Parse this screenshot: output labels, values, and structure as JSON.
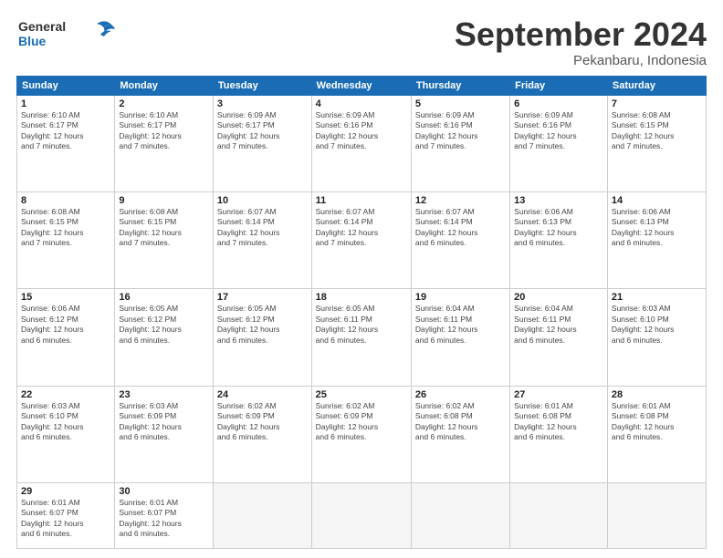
{
  "header": {
    "logo_line1": "General",
    "logo_line2": "Blue",
    "month": "September 2024",
    "location": "Pekanbaru, Indonesia"
  },
  "weekdays": [
    "Sunday",
    "Monday",
    "Tuesday",
    "Wednesday",
    "Thursday",
    "Friday",
    "Saturday"
  ],
  "weeks": [
    [
      {
        "day": "1",
        "info": "Sunrise: 6:10 AM\nSunset: 6:17 PM\nDaylight: 12 hours\nand 7 minutes."
      },
      {
        "day": "2",
        "info": "Sunrise: 6:10 AM\nSunset: 6:17 PM\nDaylight: 12 hours\nand 7 minutes."
      },
      {
        "day": "3",
        "info": "Sunrise: 6:09 AM\nSunset: 6:17 PM\nDaylight: 12 hours\nand 7 minutes."
      },
      {
        "day": "4",
        "info": "Sunrise: 6:09 AM\nSunset: 6:16 PM\nDaylight: 12 hours\nand 7 minutes."
      },
      {
        "day": "5",
        "info": "Sunrise: 6:09 AM\nSunset: 6:16 PM\nDaylight: 12 hours\nand 7 minutes."
      },
      {
        "day": "6",
        "info": "Sunrise: 6:09 AM\nSunset: 6:16 PM\nDaylight: 12 hours\nand 7 minutes."
      },
      {
        "day": "7",
        "info": "Sunrise: 6:08 AM\nSunset: 6:15 PM\nDaylight: 12 hours\nand 7 minutes."
      }
    ],
    [
      {
        "day": "8",
        "info": "Sunrise: 6:08 AM\nSunset: 6:15 PM\nDaylight: 12 hours\nand 7 minutes."
      },
      {
        "day": "9",
        "info": "Sunrise: 6:08 AM\nSunset: 6:15 PM\nDaylight: 12 hours\nand 7 minutes."
      },
      {
        "day": "10",
        "info": "Sunrise: 6:07 AM\nSunset: 6:14 PM\nDaylight: 12 hours\nand 7 minutes."
      },
      {
        "day": "11",
        "info": "Sunrise: 6:07 AM\nSunset: 6:14 PM\nDaylight: 12 hours\nand 7 minutes."
      },
      {
        "day": "12",
        "info": "Sunrise: 6:07 AM\nSunset: 6:14 PM\nDaylight: 12 hours\nand 6 minutes."
      },
      {
        "day": "13",
        "info": "Sunrise: 6:06 AM\nSunset: 6:13 PM\nDaylight: 12 hours\nand 6 minutes."
      },
      {
        "day": "14",
        "info": "Sunrise: 6:06 AM\nSunset: 6:13 PM\nDaylight: 12 hours\nand 6 minutes."
      }
    ],
    [
      {
        "day": "15",
        "info": "Sunrise: 6:06 AM\nSunset: 6:12 PM\nDaylight: 12 hours\nand 6 minutes."
      },
      {
        "day": "16",
        "info": "Sunrise: 6:05 AM\nSunset: 6:12 PM\nDaylight: 12 hours\nand 6 minutes."
      },
      {
        "day": "17",
        "info": "Sunrise: 6:05 AM\nSunset: 6:12 PM\nDaylight: 12 hours\nand 6 minutes."
      },
      {
        "day": "18",
        "info": "Sunrise: 6:05 AM\nSunset: 6:11 PM\nDaylight: 12 hours\nand 6 minutes."
      },
      {
        "day": "19",
        "info": "Sunrise: 6:04 AM\nSunset: 6:11 PM\nDaylight: 12 hours\nand 6 minutes."
      },
      {
        "day": "20",
        "info": "Sunrise: 6:04 AM\nSunset: 6:11 PM\nDaylight: 12 hours\nand 6 minutes."
      },
      {
        "day": "21",
        "info": "Sunrise: 6:03 AM\nSunset: 6:10 PM\nDaylight: 12 hours\nand 6 minutes."
      }
    ],
    [
      {
        "day": "22",
        "info": "Sunrise: 6:03 AM\nSunset: 6:10 PM\nDaylight: 12 hours\nand 6 minutes."
      },
      {
        "day": "23",
        "info": "Sunrise: 6:03 AM\nSunset: 6:09 PM\nDaylight: 12 hours\nand 6 minutes."
      },
      {
        "day": "24",
        "info": "Sunrise: 6:02 AM\nSunset: 6:09 PM\nDaylight: 12 hours\nand 6 minutes."
      },
      {
        "day": "25",
        "info": "Sunrise: 6:02 AM\nSunset: 6:09 PM\nDaylight: 12 hours\nand 6 minutes."
      },
      {
        "day": "26",
        "info": "Sunrise: 6:02 AM\nSunset: 6:08 PM\nDaylight: 12 hours\nand 6 minutes."
      },
      {
        "day": "27",
        "info": "Sunrise: 6:01 AM\nSunset: 6:08 PM\nDaylight: 12 hours\nand 6 minutes."
      },
      {
        "day": "28",
        "info": "Sunrise: 6:01 AM\nSunset: 6:08 PM\nDaylight: 12 hours\nand 6 minutes."
      }
    ],
    [
      {
        "day": "29",
        "info": "Sunrise: 6:01 AM\nSunset: 6:07 PM\nDaylight: 12 hours\nand 6 minutes."
      },
      {
        "day": "30",
        "info": "Sunrise: 6:01 AM\nSunset: 6:07 PM\nDaylight: 12 hours\nand 6 minutes."
      },
      {
        "day": "",
        "info": ""
      },
      {
        "day": "",
        "info": ""
      },
      {
        "day": "",
        "info": ""
      },
      {
        "day": "",
        "info": ""
      },
      {
        "day": "",
        "info": ""
      }
    ]
  ]
}
